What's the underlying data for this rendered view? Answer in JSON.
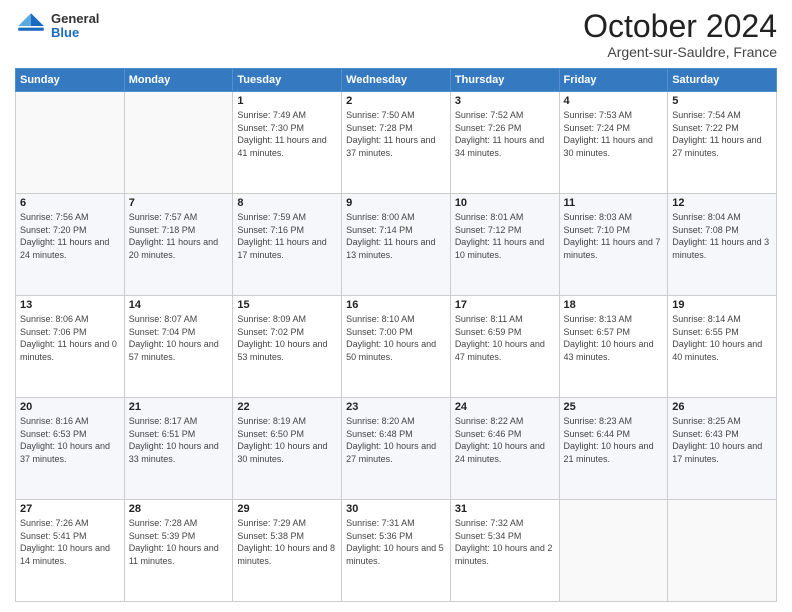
{
  "logo": {
    "general": "General",
    "blue": "Blue"
  },
  "header": {
    "month": "October 2024",
    "location": "Argent-sur-Sauldre, France"
  },
  "days_of_week": [
    "Sunday",
    "Monday",
    "Tuesday",
    "Wednesday",
    "Thursday",
    "Friday",
    "Saturday"
  ],
  "weeks": [
    [
      {
        "day": "",
        "info": ""
      },
      {
        "day": "",
        "info": ""
      },
      {
        "day": "1",
        "info": "Sunrise: 7:49 AM\nSunset: 7:30 PM\nDaylight: 11 hours and 41 minutes."
      },
      {
        "day": "2",
        "info": "Sunrise: 7:50 AM\nSunset: 7:28 PM\nDaylight: 11 hours and 37 minutes."
      },
      {
        "day": "3",
        "info": "Sunrise: 7:52 AM\nSunset: 7:26 PM\nDaylight: 11 hours and 34 minutes."
      },
      {
        "day": "4",
        "info": "Sunrise: 7:53 AM\nSunset: 7:24 PM\nDaylight: 11 hours and 30 minutes."
      },
      {
        "day": "5",
        "info": "Sunrise: 7:54 AM\nSunset: 7:22 PM\nDaylight: 11 hours and 27 minutes."
      }
    ],
    [
      {
        "day": "6",
        "info": "Sunrise: 7:56 AM\nSunset: 7:20 PM\nDaylight: 11 hours and 24 minutes."
      },
      {
        "day": "7",
        "info": "Sunrise: 7:57 AM\nSunset: 7:18 PM\nDaylight: 11 hours and 20 minutes."
      },
      {
        "day": "8",
        "info": "Sunrise: 7:59 AM\nSunset: 7:16 PM\nDaylight: 11 hours and 17 minutes."
      },
      {
        "day": "9",
        "info": "Sunrise: 8:00 AM\nSunset: 7:14 PM\nDaylight: 11 hours and 13 minutes."
      },
      {
        "day": "10",
        "info": "Sunrise: 8:01 AM\nSunset: 7:12 PM\nDaylight: 11 hours and 10 minutes."
      },
      {
        "day": "11",
        "info": "Sunrise: 8:03 AM\nSunset: 7:10 PM\nDaylight: 11 hours and 7 minutes."
      },
      {
        "day": "12",
        "info": "Sunrise: 8:04 AM\nSunset: 7:08 PM\nDaylight: 11 hours and 3 minutes."
      }
    ],
    [
      {
        "day": "13",
        "info": "Sunrise: 8:06 AM\nSunset: 7:06 PM\nDaylight: 11 hours and 0 minutes."
      },
      {
        "day": "14",
        "info": "Sunrise: 8:07 AM\nSunset: 7:04 PM\nDaylight: 10 hours and 57 minutes."
      },
      {
        "day": "15",
        "info": "Sunrise: 8:09 AM\nSunset: 7:02 PM\nDaylight: 10 hours and 53 minutes."
      },
      {
        "day": "16",
        "info": "Sunrise: 8:10 AM\nSunset: 7:00 PM\nDaylight: 10 hours and 50 minutes."
      },
      {
        "day": "17",
        "info": "Sunrise: 8:11 AM\nSunset: 6:59 PM\nDaylight: 10 hours and 47 minutes."
      },
      {
        "day": "18",
        "info": "Sunrise: 8:13 AM\nSunset: 6:57 PM\nDaylight: 10 hours and 43 minutes."
      },
      {
        "day": "19",
        "info": "Sunrise: 8:14 AM\nSunset: 6:55 PM\nDaylight: 10 hours and 40 minutes."
      }
    ],
    [
      {
        "day": "20",
        "info": "Sunrise: 8:16 AM\nSunset: 6:53 PM\nDaylight: 10 hours and 37 minutes."
      },
      {
        "day": "21",
        "info": "Sunrise: 8:17 AM\nSunset: 6:51 PM\nDaylight: 10 hours and 33 minutes."
      },
      {
        "day": "22",
        "info": "Sunrise: 8:19 AM\nSunset: 6:50 PM\nDaylight: 10 hours and 30 minutes."
      },
      {
        "day": "23",
        "info": "Sunrise: 8:20 AM\nSunset: 6:48 PM\nDaylight: 10 hours and 27 minutes."
      },
      {
        "day": "24",
        "info": "Sunrise: 8:22 AM\nSunset: 6:46 PM\nDaylight: 10 hours and 24 minutes."
      },
      {
        "day": "25",
        "info": "Sunrise: 8:23 AM\nSunset: 6:44 PM\nDaylight: 10 hours and 21 minutes."
      },
      {
        "day": "26",
        "info": "Sunrise: 8:25 AM\nSunset: 6:43 PM\nDaylight: 10 hours and 17 minutes."
      }
    ],
    [
      {
        "day": "27",
        "info": "Sunrise: 7:26 AM\nSunset: 5:41 PM\nDaylight: 10 hours and 14 minutes."
      },
      {
        "day": "28",
        "info": "Sunrise: 7:28 AM\nSunset: 5:39 PM\nDaylight: 10 hours and 11 minutes."
      },
      {
        "day": "29",
        "info": "Sunrise: 7:29 AM\nSunset: 5:38 PM\nDaylight: 10 hours and 8 minutes."
      },
      {
        "day": "30",
        "info": "Sunrise: 7:31 AM\nSunset: 5:36 PM\nDaylight: 10 hours and 5 minutes."
      },
      {
        "day": "31",
        "info": "Sunrise: 7:32 AM\nSunset: 5:34 PM\nDaylight: 10 hours and 2 minutes."
      },
      {
        "day": "",
        "info": ""
      },
      {
        "day": "",
        "info": ""
      }
    ]
  ]
}
